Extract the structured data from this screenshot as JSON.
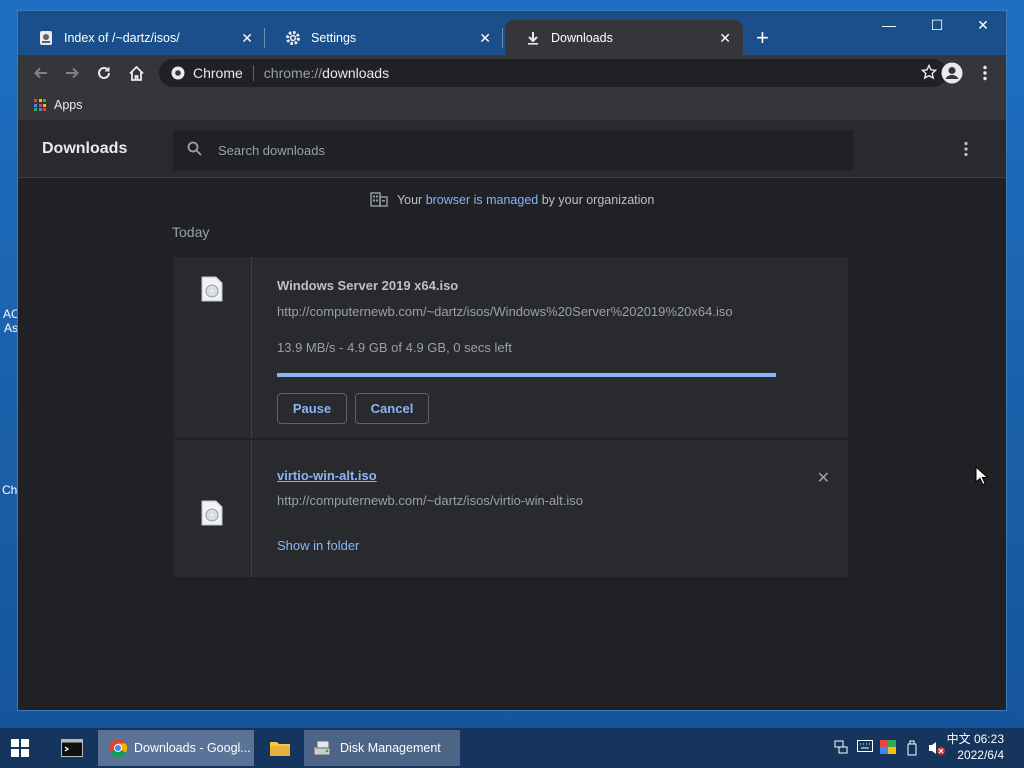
{
  "desktop": {
    "fragments": [
      "AC",
      "As",
      "Ch"
    ]
  },
  "tabs": [
    {
      "title": "Index of /~dartz/isos/",
      "icon": "page-icon",
      "active": false
    },
    {
      "title": "Settings",
      "icon": "gear-icon",
      "active": false
    },
    {
      "title": "Downloads",
      "icon": "download-icon",
      "active": true
    }
  ],
  "window_controls": {
    "minimize": "—",
    "maximize": "☐",
    "close": "✕"
  },
  "toolbar": {
    "chip_label": "Chrome",
    "url_scheme": "chrome://",
    "url_host": "downloads"
  },
  "bookmarks": {
    "apps_label": "Apps"
  },
  "downloads": {
    "title": "Downloads",
    "search_placeholder": "Search downloads",
    "managed": {
      "prefix": "Your",
      "link": "browser is managed",
      "suffix": "by your organization"
    },
    "section": "Today",
    "items": [
      {
        "name": "Windows Server 2019 x64.iso",
        "url": "http://computernewb.com/~dartz/isos/Windows%20Server%202019%20x64.iso",
        "status": "13.9 MB/s - 4.9 GB of 4.9 GB, 0 secs left",
        "progress": 1.0,
        "buttons": {
          "pause": "Pause",
          "cancel": "Cancel"
        }
      },
      {
        "name": "virtio-win-alt.iso",
        "url": "http://computernewb.com/~dartz/isos/virtio-win-alt.iso",
        "link": "Show in folder",
        "remove": "✕"
      }
    ]
  },
  "taskbar": {
    "chrome_item": "Downloads - Googl...",
    "disk_item": "Disk Management",
    "clock_time": "中文 06:23",
    "clock_date": "2022/6/4"
  },
  "colors": {
    "accent": "#8ab4f8",
    "page_bg": "#202124",
    "card_bg": "#292a2d",
    "tabstrip": "#1a4f8c"
  }
}
